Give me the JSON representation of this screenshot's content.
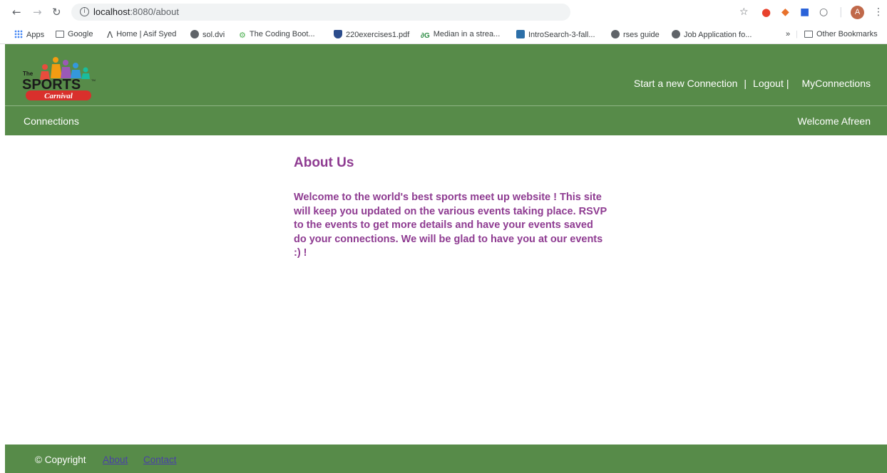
{
  "browser": {
    "url_host": "localhost",
    "url_path": ":8080/about",
    "avatar_letter": "A",
    "bookmarks": [
      {
        "label": "Apps",
        "icon": "apps-grid-icon"
      },
      {
        "label": "Google",
        "icon": "folder-icon"
      },
      {
        "label": "Home | Asif Syed",
        "icon": "a-letter-icon"
      },
      {
        "label": "sol.dvi",
        "icon": "globe-icon"
      },
      {
        "label": "The Coding Boot...",
        "icon": "code-icon"
      },
      {
        "label": "220exercises1.pdf",
        "icon": "shield-icon"
      },
      {
        "label": "Median in a strea...",
        "icon": "geeks-icon"
      },
      {
        "label": "IntroSearch-3-fall...",
        "icon": "square-icon"
      },
      {
        "label": "rses guide",
        "icon": "globe-icon"
      },
      {
        "label": "Job Application fo...",
        "icon": "globe-icon"
      }
    ],
    "overflow": "»",
    "other_bookmarks": "Other Bookmarks"
  },
  "site": {
    "logo": {
      "the": "The",
      "sports": "SPORTS",
      "carnival": "Carnival",
      "tm": "TM"
    },
    "header_links": {
      "new_connection": "Start a new Connection",
      "separator": "|",
      "logout": "Logout",
      "my_connections": "MyConnections"
    },
    "sub_header": {
      "left": "Connections",
      "right": "Welcome Afreen"
    },
    "content": {
      "title": "About Us",
      "body": "Welcome to the world's best sports meet up website ! This site will keep you updated on the various events taking place. RSVP to the events to get more details and have your events saved do your connections. We will be glad to have you at our events :) !"
    },
    "footer": {
      "copyright": "© Copyright",
      "about": "About",
      "contact": "Contact"
    }
  },
  "colors": {
    "header_green": "#578b49",
    "content_purple": "#8e3b91",
    "footer_link": "#4a3fa8"
  }
}
